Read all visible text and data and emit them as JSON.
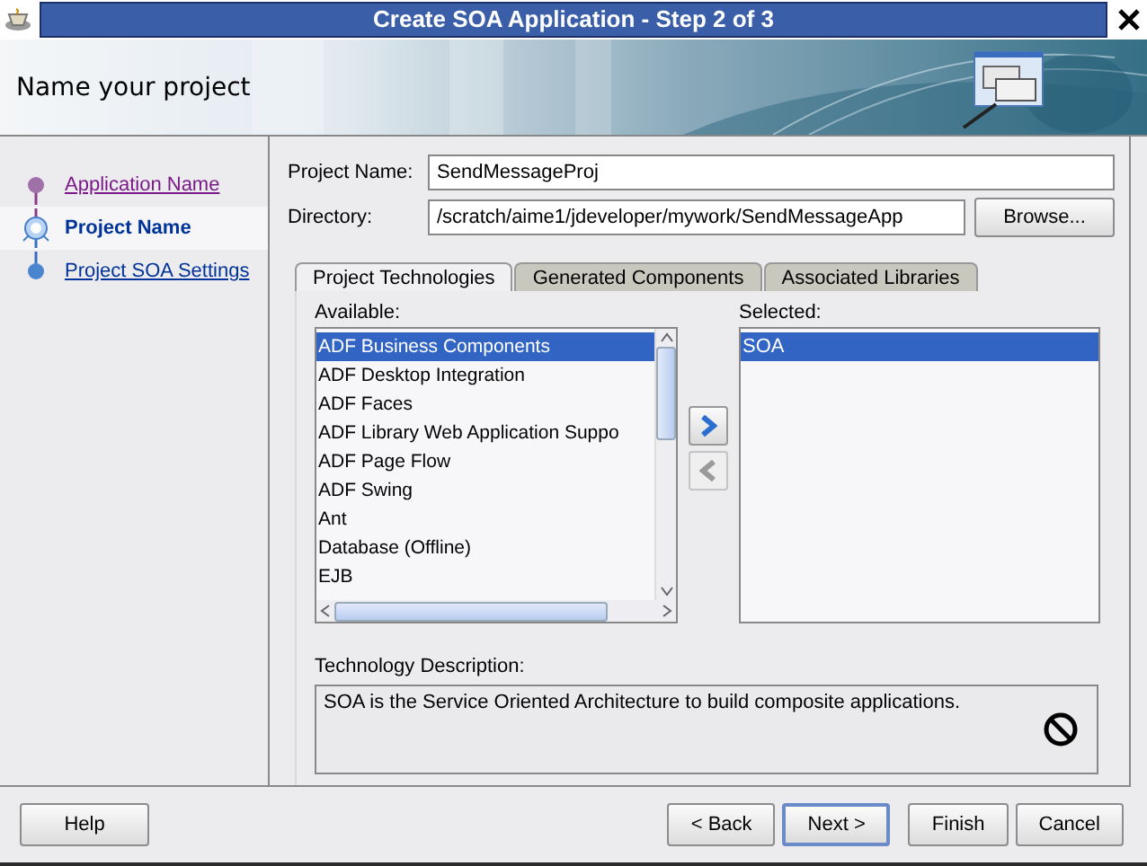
{
  "window": {
    "title": "Create SOA Application - Step 2 of 3"
  },
  "header": {
    "title": "Name your project"
  },
  "steps": [
    {
      "label": "Application Name",
      "visited": true,
      "selected": false
    },
    {
      "label": "Project Name",
      "visited": false,
      "selected": true
    },
    {
      "label": "Project SOA Settings",
      "visited": false,
      "selected": false
    }
  ],
  "fields": [
    {
      "label": "Project Name:",
      "value": "SendMessageProj"
    },
    {
      "label": "Directory:",
      "value": "/scratch/aime1/jdeveloper/mywork/SendMessageApp"
    }
  ],
  "browse_button": "Browse...",
  "tabs": [
    {
      "label": "Project Technologies",
      "selected": true
    },
    {
      "label": "Generated Components",
      "selected": false
    },
    {
      "label": "Associated Libraries",
      "selected": false
    }
  ],
  "available": {
    "label": "Available:",
    "items": [
      {
        "label": "ADF Business Components",
        "selected": true
      },
      {
        "label": "ADF Desktop Integration",
        "selected": false
      },
      {
        "label": "ADF Faces",
        "selected": false
      },
      {
        "label": "ADF Library Web Application Suppo",
        "selected": false
      },
      {
        "label": "ADF Page Flow",
        "selected": false
      },
      {
        "label": "ADF Swing",
        "selected": false
      },
      {
        "label": "Ant",
        "selected": false
      },
      {
        "label": "Database (Offline)",
        "selected": false
      },
      {
        "label": "EJB",
        "selected": false
      }
    ]
  },
  "move_buttons": [
    {
      "kind": "add",
      "disabled": false
    },
    {
      "kind": "remove",
      "disabled": true
    }
  ],
  "selected_list": {
    "label": "Selected:",
    "items": [
      {
        "label": "SOA",
        "selected": true
      }
    ]
  },
  "description": {
    "label": "Technology Description:",
    "text": "SOA is the Service Oriented Architecture to build composite applications."
  },
  "buttons": [
    {
      "label": "Help",
      "default": false
    },
    {
      "label": "< Back",
      "default": false
    },
    {
      "label": "Next >",
      "default": true
    },
    {
      "label": "Finish",
      "default": false
    },
    {
      "label": "Cancel",
      "default": false
    }
  ]
}
